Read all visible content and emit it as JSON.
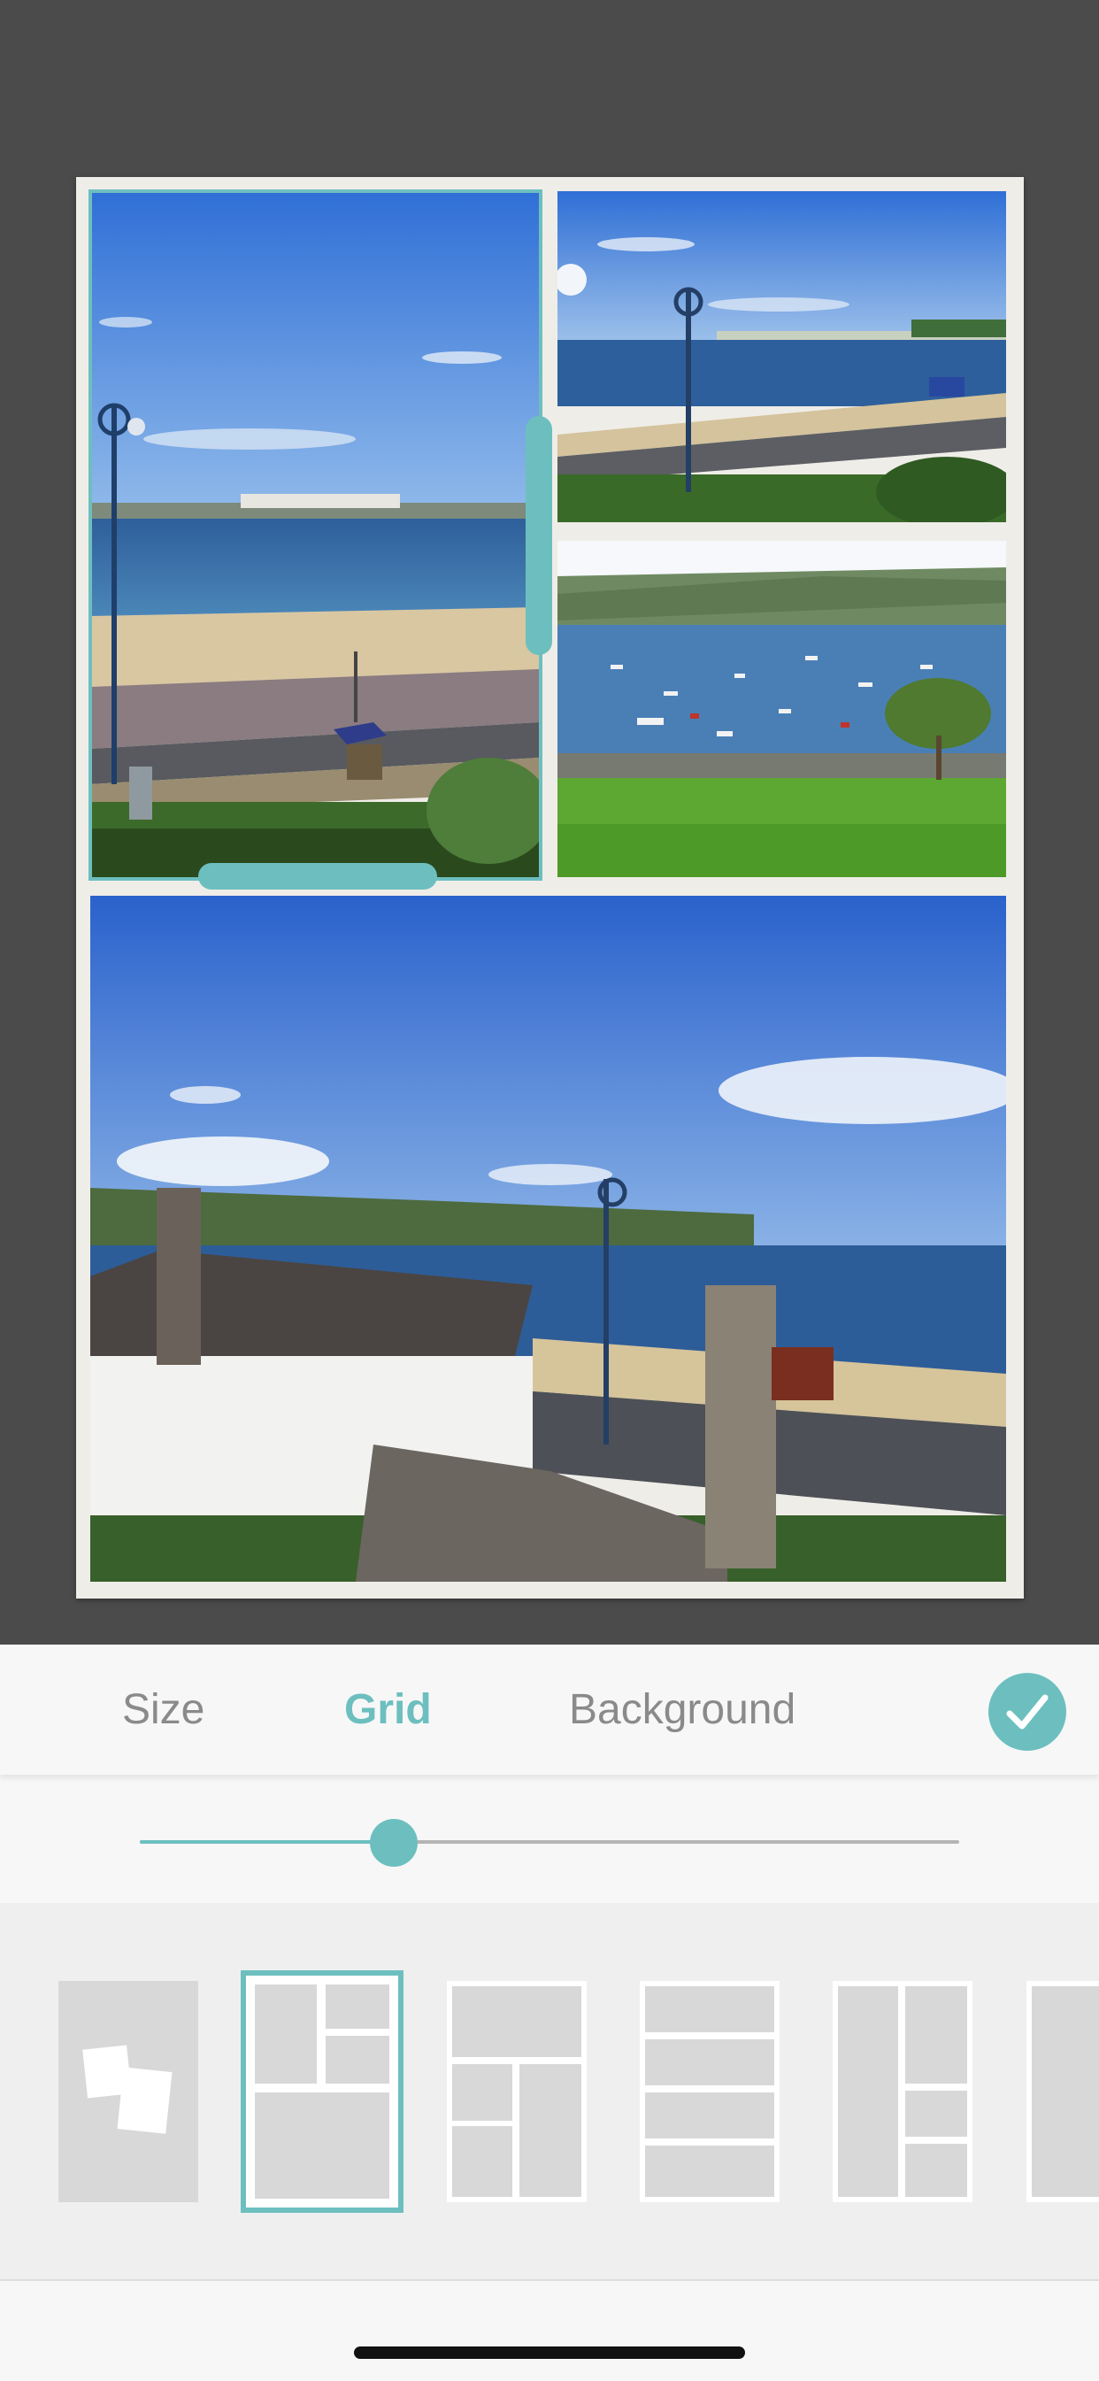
{
  "tabs": {
    "size_label": "Size",
    "grid_label": "Grid",
    "background_label": "Background",
    "active": "Grid"
  },
  "confirm": {
    "icon": "checkmark-icon"
  },
  "slider": {
    "value": 0.31
  },
  "layouts": [
    {
      "name": "freeform",
      "selected": false
    },
    {
      "name": "grid-large-left-two-right-bottom-wide",
      "selected": true
    },
    {
      "name": "grid-top-wide-split-bottom",
      "selected": false
    },
    {
      "name": "grid-four-rows",
      "selected": false
    },
    {
      "name": "grid-left-tall-three-right",
      "selected": false
    },
    {
      "name": "grid-partial",
      "selected": false
    }
  ],
  "colors": {
    "accent": "#6dbfbf",
    "canvas_background": "#4b4b4b",
    "frame_background": "#efede8",
    "tab_inactive": "#8a8a8a"
  },
  "photos": [
    {
      "name": "beach-promenade-lamp",
      "selected": true
    },
    {
      "name": "bay-boats-lamp",
      "selected": false
    },
    {
      "name": "harbour-boats-green",
      "selected": false
    },
    {
      "name": "coast-rooftops",
      "selected": false
    }
  ]
}
